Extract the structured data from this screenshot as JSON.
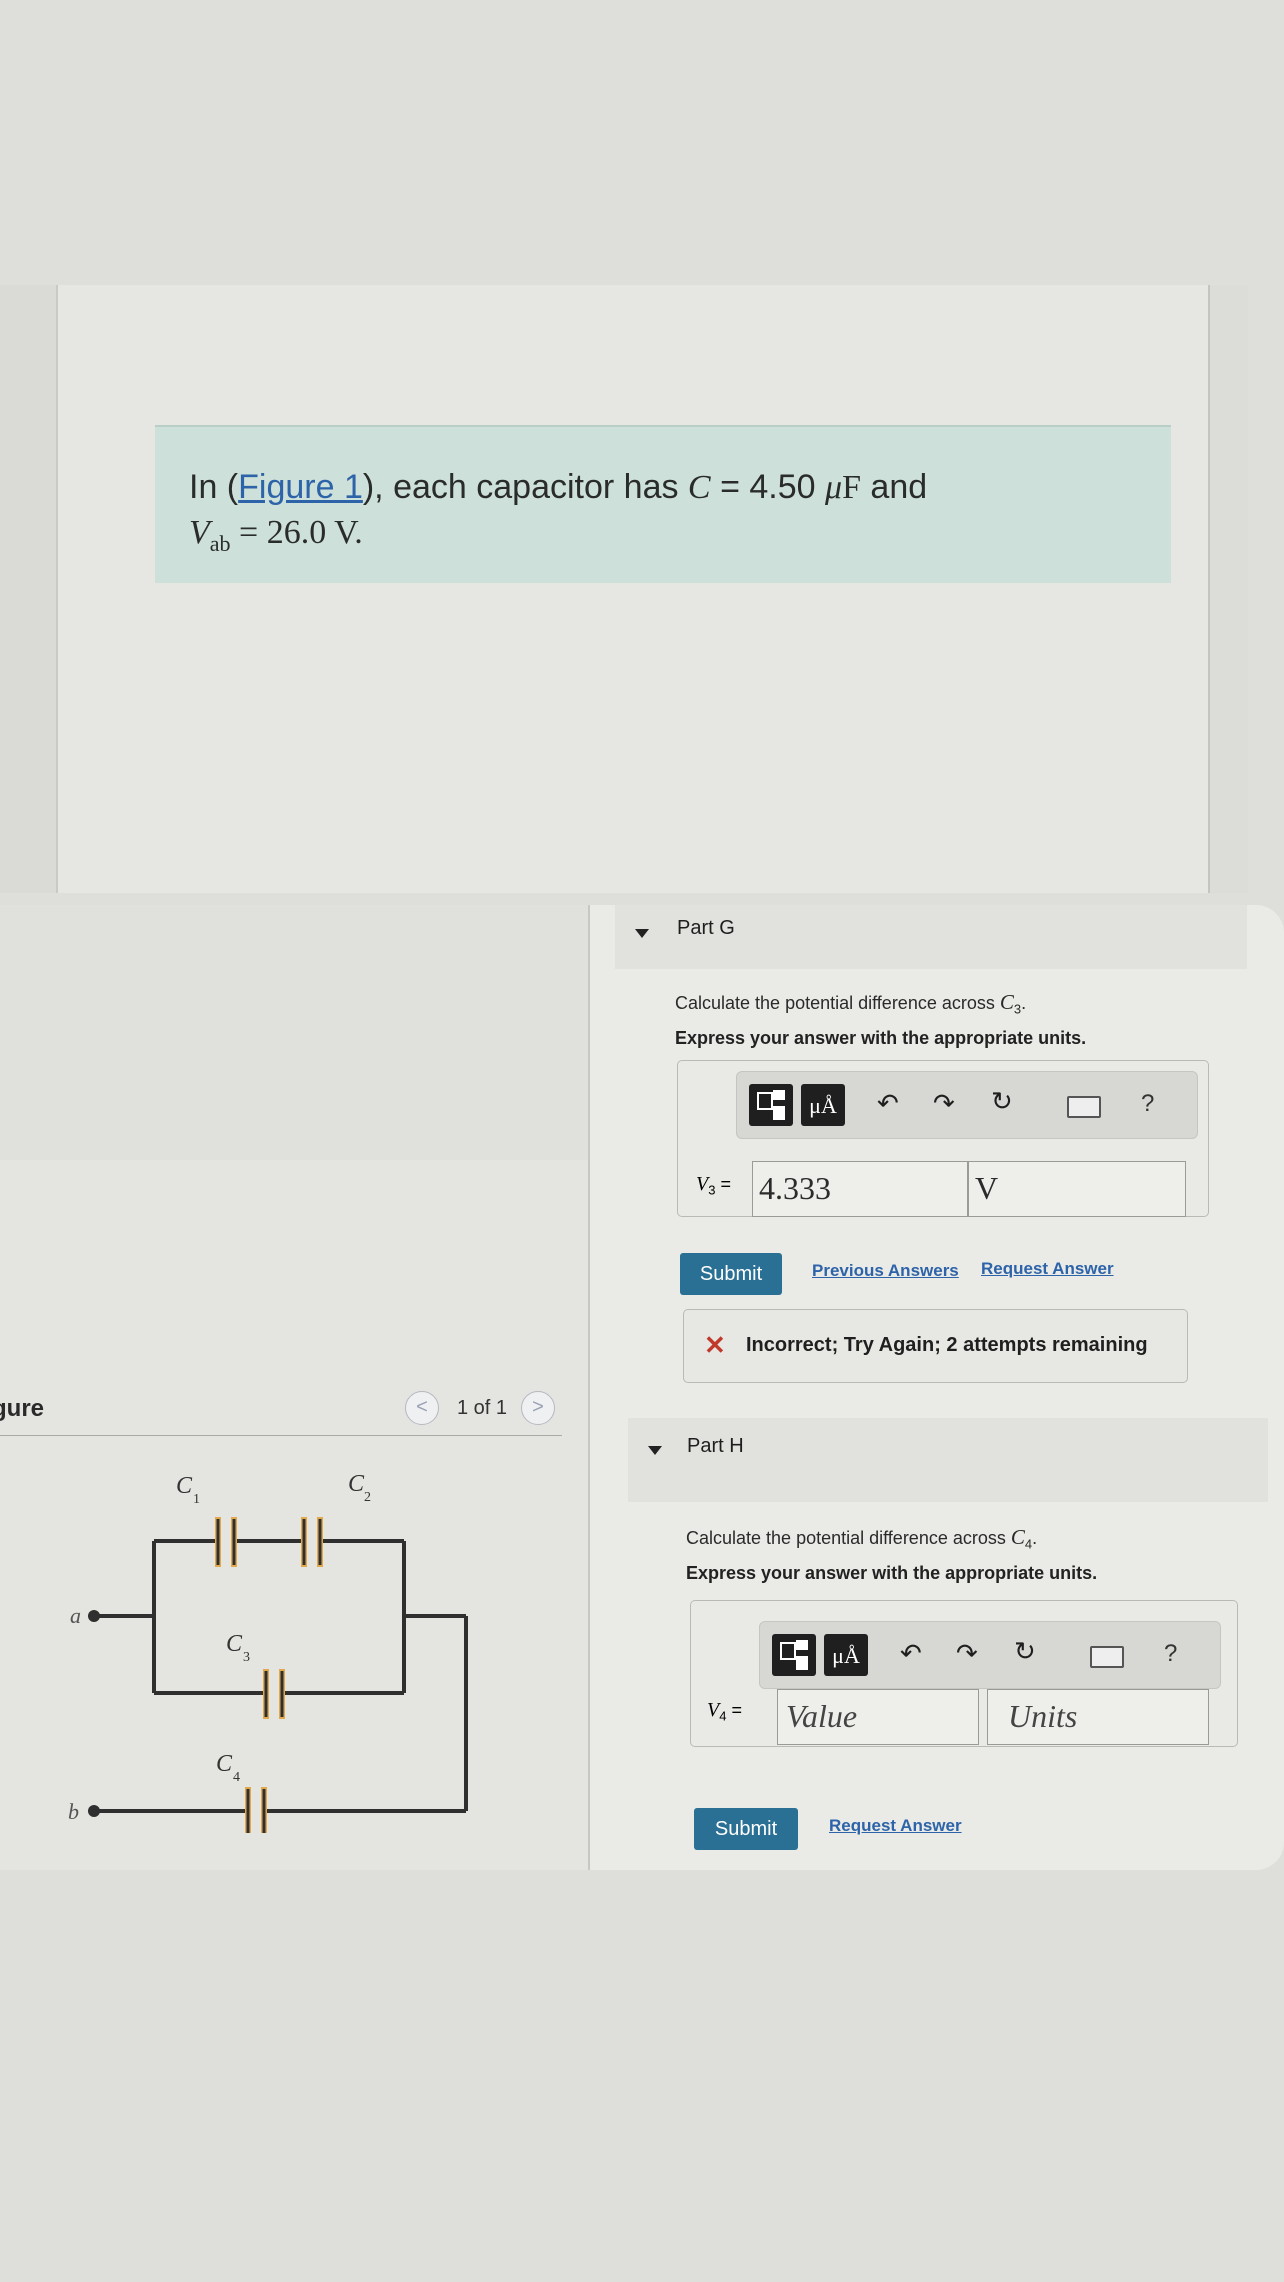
{
  "problem": {
    "intro_prefix": "In (",
    "figure_link": "Figure 1",
    "intro_mid": "), each capacitor has ",
    "c_symbol": "C",
    "c_value": "= 4.50 ",
    "c_unit_mu": "μ",
    "c_unit_F": "F",
    "and": " and",
    "vab_symbol": "V",
    "vab_sub": "ab",
    "vab_value": " = 26.0 V."
  },
  "figure": {
    "label": "gure",
    "pager": "1 of 1",
    "prev": "<",
    "next": ">",
    "circuit_labels": {
      "C1": "C",
      "C1_sub": "1",
      "C2": "C",
      "C2_sub": "2",
      "C3": "C",
      "C3_sub": "3",
      "C4": "C",
      "C4_sub": "4",
      "a": "a",
      "b": "b"
    },
    "colors": {
      "wire": "#2f2f2f",
      "capacitor_plate": "#e0aa4c"
    }
  },
  "partG": {
    "title": "Part G",
    "question_prefix": "Calculate the potential difference across ",
    "question_var": "C",
    "question_sub": "3",
    "question_suffix": ".",
    "instruction": "Express your answer with the appropriate units.",
    "var_label": "V",
    "var_sub": "3",
    "equals": "=",
    "value": "4.333",
    "units": "V",
    "submit": "Submit",
    "previous_answers": "Previous Answers",
    "request_answer": "Request Answer",
    "feedback_icon": "✕",
    "feedback": "Incorrect; Try Again; 2 attempts remaining"
  },
  "partH": {
    "title": "Part H",
    "question_prefix": "Calculate the potential difference across ",
    "question_var": "C",
    "question_sub": "4",
    "question_suffix": ".",
    "instruction": "Express your answer with the appropriate units.",
    "var_label": "V",
    "var_sub": "4",
    "equals": "=",
    "value_placeholder": "Value",
    "units_placeholder": "Units",
    "submit": "Submit",
    "request_answer": "Request Answer"
  },
  "toolbar": {
    "mu_label": "μÅ",
    "icons": [
      "templates-icon",
      "units-icon",
      "undo-icon",
      "redo-icon",
      "reset-icon",
      "keyboard-icon",
      "help-icon"
    ],
    "help": "?"
  },
  "colors": {
    "intro_bg": "#cde0d9",
    "submit_bg": "#2a6f94",
    "link": "#2d63a8",
    "error": "#c0392b"
  }
}
